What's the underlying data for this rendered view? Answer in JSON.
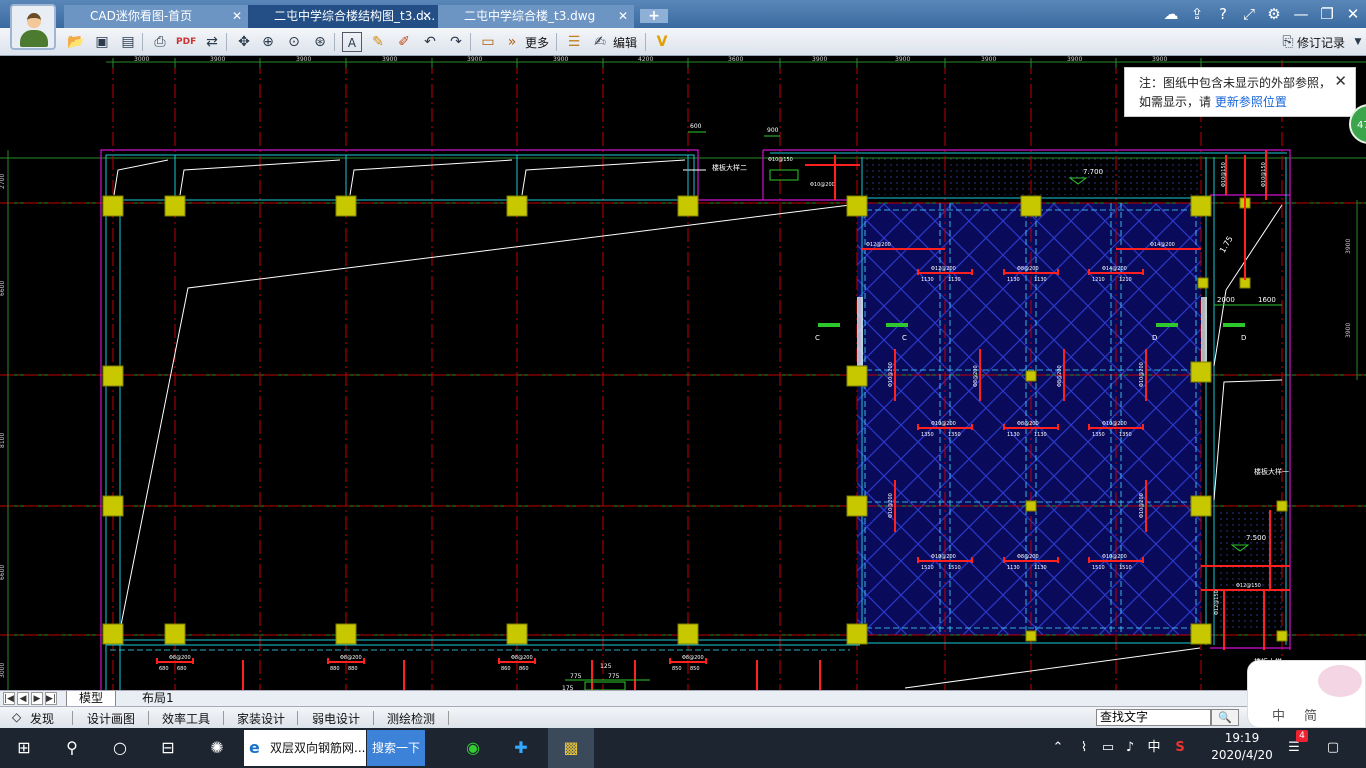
{
  "tabs": [
    {
      "label": "CAD迷你看图-首页",
      "close": "✕"
    },
    {
      "label": "二屯中学综合楼结构图_t3.d...",
      "close": "✕"
    },
    {
      "label": "二屯中学综合楼_t3.dwg",
      "close": "✕"
    }
  ],
  "new_tab": "+",
  "toolbar": {
    "more": "更多",
    "edit": "编辑",
    "revision": "修订记录"
  },
  "note": {
    "line1": "注：图纸中包含未显示的外部参照，",
    "line2": "如需显示，请",
    "link": "更新参照位置",
    "close": "✕"
  },
  "badge": "47",
  "layout_tabs": [
    "模型",
    "布局1"
  ],
  "bottom_tools": [
    "发现",
    "设计画图",
    "效率工具",
    "家装设计",
    "弱电设计",
    "测绘检测"
  ],
  "search": {
    "value": "查找文字"
  },
  "ime": {
    "mode": "中",
    "script": "简"
  },
  "taskbar": {
    "app": "双层双向钢筋网...",
    "search_button": "搜索一下",
    "time": "19:19",
    "date": "2020/4/20",
    "lang": "中",
    "notifications": "4"
  },
  "drawing": {
    "top_dims": [
      "3000",
      "3900",
      "3900",
      "3900",
      "3900",
      "3900",
      "4200",
      "3600",
      "3900",
      "3900",
      "3900",
      "3900",
      "3900"
    ],
    "left_dims": [
      "2700",
      "6600",
      "8100",
      "6600",
      "3000"
    ],
    "right_dims": [
      "3900",
      "3900"
    ],
    "small_dims": [
      "600",
      "900"
    ],
    "labels": {
      "beam1": "楼板大样二",
      "beam2": "楼板大样一",
      "beam3": "楼板大样一",
      "elev1": "7.700",
      "elev2": "7.500",
      "slope": "1.75",
      "dim2000": "2000",
      "dim1600": "1600",
      "cutC": "C",
      "cutD": "D",
      "rebar_top1": "Φ10@150",
      "rebar_top2": "Φ10@200",
      "rebar_right1": "Φ10@150",
      "rebar_right2": "Φ10@150",
      "slab_r1": "Φ12@150",
      "slab_r2": "Φ12@150",
      "dims_bottom": [
        "775",
        "125",
        "775",
        "175"
      ]
    },
    "rebar_groups": [
      {
        "code": "Φ12@200",
        "d1": "1130",
        "d2": "1130"
      },
      {
        "code": "Φ8@200",
        "d1": "1130",
        "d2": "1130"
      },
      {
        "code": "Φ14@200",
        "d1": "1210",
        "d2": "1210"
      },
      {
        "code": "Φ10@200",
        "d1": "1350",
        "d2": "1350"
      },
      {
        "code": "Φ8@200",
        "d1": "1130",
        "d2": "1130"
      },
      {
        "code": "Φ10@200",
        "d1": "1350",
        "d2": "1350"
      },
      {
        "code": "Φ10@200",
        "d1": "1510",
        "d2": "1510"
      },
      {
        "code": "Φ8@200",
        "d1": "1130",
        "d2": "1130"
      },
      {
        "code": "Φ10@200",
        "d1": "1510",
        "d2": "1510"
      }
    ],
    "vertical_rebar": [
      "Φ10@200",
      "Φ8@200",
      "Φ8@200",
      "Φ10@200",
      "Φ10@200",
      "Φ10@200"
    ],
    "bottom_rebar": [
      {
        "code": "Φ8@200",
        "d1": "680",
        "d2": "680"
      },
      {
        "code": "Φ8@200",
        "d1": "880",
        "d2": "880"
      },
      {
        "code": "Φ8@200",
        "d1": "860",
        "d2": "860"
      },
      {
        "code": "Φ8@200",
        "d1": "850",
        "d2": "850"
      }
    ]
  }
}
